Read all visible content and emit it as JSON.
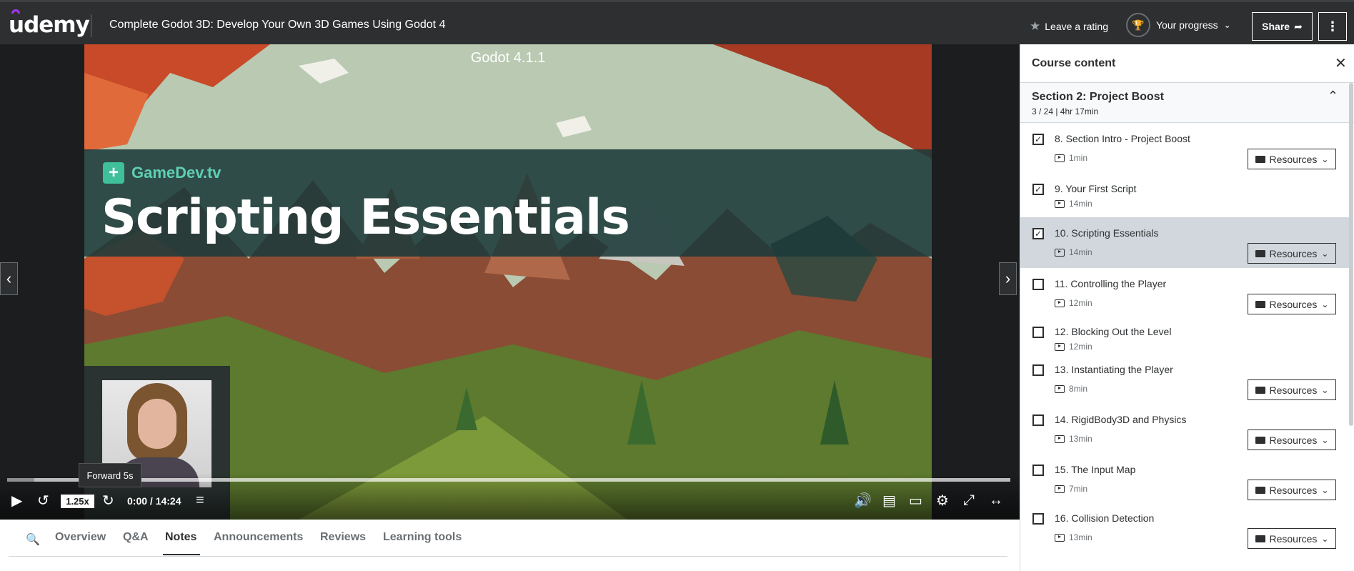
{
  "header": {
    "logo": "udemy",
    "course_title": "Complete Godot 3D: Develop Your Own 3D Games Using Godot 4",
    "rating_label": "Leave a rating",
    "progress_label": "Your progress",
    "share_label": "Share",
    "more_label": "⋮"
  },
  "video": {
    "version_text": "Godot 4.1.1",
    "brand": "GameDev.tv",
    "slide_title": "Scripting Essentials",
    "tooltip": "Forward 5s",
    "speed": "1.25x",
    "time": "0:00 / 14:24",
    "progress_fraction": 0.027
  },
  "tabs": [
    {
      "label": "Overview"
    },
    {
      "label": "Q&A"
    },
    {
      "label": "Notes"
    },
    {
      "label": "Announcements"
    },
    {
      "label": "Reviews"
    },
    {
      "label": "Learning tools"
    }
  ],
  "active_tab": "Notes",
  "sidebar": {
    "title": "Course content",
    "section_title": "Section 2: Project Boost",
    "section_meta": "3 / 24 | 4hr 17min",
    "resources_label": "Resources",
    "items": [
      {
        "label": "8. Section Intro - Project Boost",
        "duration": "1min",
        "checked": true,
        "resources": true
      },
      {
        "label": "9. Your First Script",
        "duration": "14min",
        "checked": true,
        "resources": false
      },
      {
        "label": "10. Scripting Essentials",
        "duration": "14min",
        "checked": true,
        "resources": true,
        "selected": true
      },
      {
        "label": "11. Controlling the Player",
        "duration": "12min",
        "checked": false,
        "resources": true
      },
      {
        "label": "12. Blocking Out the Level",
        "duration": "12min",
        "checked": false,
        "resources": false
      },
      {
        "label": "13. Instantiating the Player",
        "duration": "8min",
        "checked": false,
        "resources": true
      },
      {
        "label": "14. RigidBody3D and Physics",
        "duration": "13min",
        "checked": false,
        "resources": true
      },
      {
        "label": "15. The Input Map",
        "duration": "7min",
        "checked": false,
        "resources": true
      },
      {
        "label": "16. Collision Detection",
        "duration": "13min",
        "checked": false,
        "resources": true
      }
    ]
  },
  "colors": {
    "header_bg": "#2d2f31",
    "accent": "#a435f0",
    "selected_row": "#d1d7dc",
    "banner_bg": "#1c3a3a",
    "brand_green": "#5ed0b0"
  }
}
